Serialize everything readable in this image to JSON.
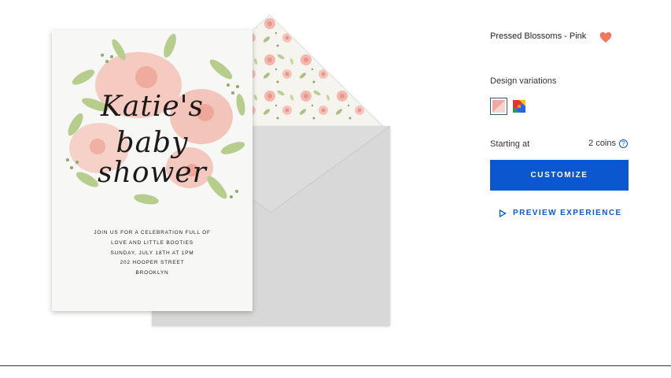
{
  "product": {
    "title": "Pressed Blossoms - Pink",
    "favorite_icon": "heart-icon",
    "favorite_color": "#f4775f"
  },
  "variations": {
    "label": "Design variations",
    "swatches": [
      {
        "name": "pink",
        "selected": true,
        "colors": [
          "#f0a8a0",
          "#f7d4cf"
        ]
      },
      {
        "name": "multicolor",
        "selected": false,
        "colors": [
          "#e8322e",
          "#f7c21b",
          "#1f9d55",
          "#2a66d9"
        ]
      }
    ]
  },
  "pricing": {
    "label": "Starting at",
    "value": "2 coins",
    "help_icon": "question-circle-icon"
  },
  "actions": {
    "customize_label": "CUSTOMIZE",
    "preview_label": "PREVIEW EXPERIENCE",
    "preview_icon": "play-outline-icon",
    "accent_color": "#0a57d0"
  },
  "card": {
    "title_lines": [
      "Katie's",
      "baby",
      "shower"
    ],
    "details": [
      "JOIN US FOR A CELEBRATION FULL OF",
      "LOVE AND LITTLE BOOTIES",
      "SUNDAY, JULY 18TH AT 1PM",
      "202 HOOPER STREET",
      "BROOKLYN"
    ]
  }
}
